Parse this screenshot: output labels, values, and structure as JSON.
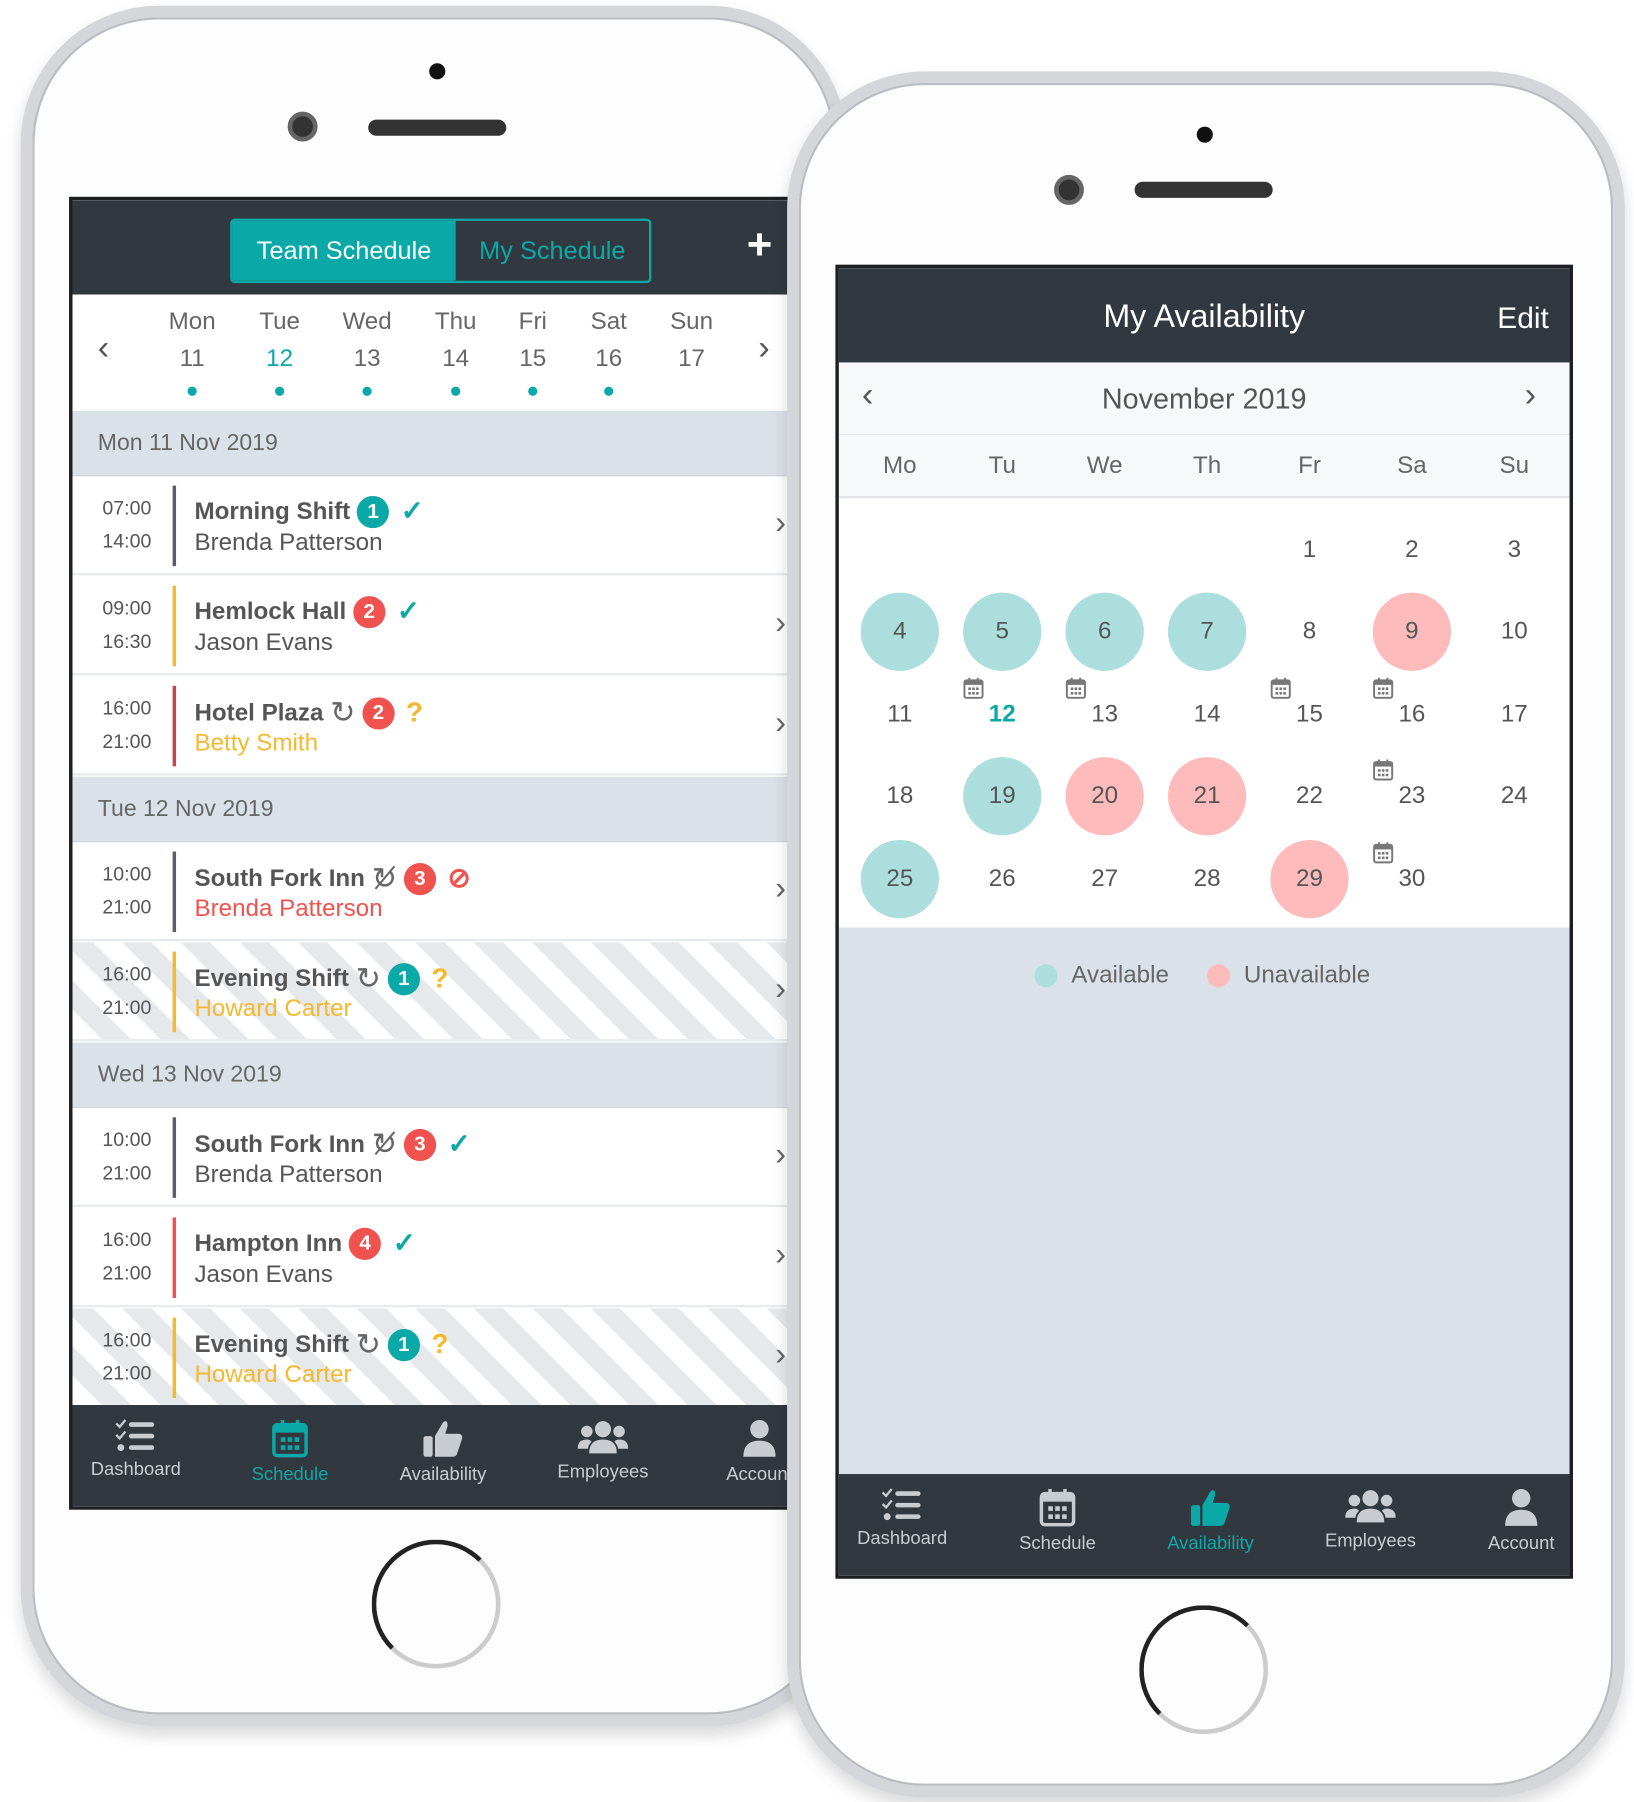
{
  "team_schedule": {
    "tabs": [
      {
        "label": "Team Schedule",
        "active": true
      },
      {
        "label": "My Schedule",
        "active": false
      }
    ],
    "add_icon": "plus-icon",
    "week": [
      {
        "day": "Mon",
        "date": "11",
        "has_shifts": true
      },
      {
        "day": "Tue",
        "date": "12",
        "has_shifts": true,
        "today": true
      },
      {
        "day": "Wed",
        "date": "13",
        "has_shifts": true
      },
      {
        "day": "Thu",
        "date": "14",
        "has_shifts": true
      },
      {
        "day": "Fri",
        "date": "15",
        "has_shifts": true
      },
      {
        "day": "Sat",
        "date": "16",
        "has_shifts": true
      },
      {
        "day": "Sun",
        "date": "17",
        "has_shifts": false
      }
    ],
    "groups": [
      {
        "date": "Mon 11 Nov 2019",
        "shifts": [
          {
            "start": "07:00",
            "end": "14:00",
            "title": "Morning Shift",
            "repeat": "",
            "badge": "1",
            "badge_color": "#0aa8a7",
            "status": "confirmed",
            "employee": "Brenda Patterson",
            "employee_color": "#555555",
            "bar_color": "#5a5f66",
            "striped": false
          },
          {
            "start": "09:00",
            "end": "16:30",
            "title": "Hemlock Hall",
            "repeat": "",
            "badge": "2",
            "badge_color": "#f0534f",
            "status": "confirmed",
            "employee": "Jason Evans",
            "employee_color": "#555555",
            "bar_color": "#f5b82e",
            "striped": false
          },
          {
            "start": "16:00",
            "end": "21:00",
            "title": "Hotel Plaza",
            "repeat": "repeat",
            "badge": "2",
            "badge_color": "#f0534f",
            "status": "pending",
            "employee": "Betty Smith",
            "employee_color": "#f5b82e",
            "bar_color": "#c0474a",
            "striped": false
          }
        ]
      },
      {
        "date": "Tue 12 Nov 2019",
        "shifts": [
          {
            "start": "10:00",
            "end": "21:00",
            "title": "South Fork Inn",
            "repeat": "repeat-off",
            "badge": "3",
            "badge_color": "#f0534f",
            "status": "declined",
            "employee": "Brenda Patterson",
            "employee_color": "#f0534f",
            "bar_color": "#5a5f66",
            "striped": false
          },
          {
            "start": "16:00",
            "end": "21:00",
            "title": "Evening Shift",
            "repeat": "repeat",
            "badge": "1",
            "badge_color": "#0aa8a7",
            "status": "pending",
            "employee": "Howard Carter",
            "employee_color": "#f5b82e",
            "bar_color": "#f5b82e",
            "striped": true
          }
        ]
      },
      {
        "date": "Wed 13 Nov 2019",
        "shifts": [
          {
            "start": "10:00",
            "end": "21:00",
            "title": "South Fork Inn",
            "repeat": "repeat-off",
            "badge": "3",
            "badge_color": "#f0534f",
            "status": "confirmed",
            "employee": "Brenda Patterson",
            "employee_color": "#555555",
            "bar_color": "#5a5f66",
            "striped": false
          },
          {
            "start": "16:00",
            "end": "21:00",
            "title": "Hampton Inn",
            "repeat": "",
            "badge": "4",
            "badge_color": "#f0534f",
            "status": "confirmed",
            "employee": "Jason Evans",
            "employee_color": "#555555",
            "bar_color": "#f0534f",
            "striped": false
          },
          {
            "start": "16:00",
            "end": "21:00",
            "title": "Evening Shift",
            "repeat": "repeat",
            "badge": "1",
            "badge_color": "#0aa8a7",
            "status": "pending",
            "employee": "Howard Carter",
            "employee_color": "#f5b82e",
            "bar_color": "#f5b82e",
            "striped": true
          }
        ]
      }
    ],
    "nav": [
      {
        "label": "Dashboard",
        "icon": "checklist-icon"
      },
      {
        "label": "Schedule",
        "icon": "calendar-icon",
        "active": true
      },
      {
        "label": "Availability",
        "icon": "thumbs-up-icon"
      },
      {
        "label": "Employees",
        "icon": "users-icon"
      },
      {
        "label": "Account",
        "icon": "user-icon"
      }
    ]
  },
  "availability": {
    "title": "My Availability",
    "edit_label": "Edit",
    "month": "November 2019",
    "weekdays": [
      "Mo",
      "Tu",
      "We",
      "Th",
      "Fr",
      "Sa",
      "Su"
    ],
    "days_in_month": 30,
    "first_weekday_index": 4,
    "today": 12,
    "available": [
      4,
      5,
      6,
      7,
      19,
      25
    ],
    "unavailable": [
      9,
      20,
      21,
      29
    ],
    "scheduled": [
      12,
      13,
      15,
      16,
      23,
      30
    ],
    "legend": [
      {
        "label": "Available",
        "color": "#abdedd"
      },
      {
        "label": "Unavailable",
        "color": "#fdbcbb"
      }
    ],
    "nav": [
      {
        "label": "Dashboard",
        "icon": "checklist-icon"
      },
      {
        "label": "Schedule",
        "icon": "calendar-icon"
      },
      {
        "label": "Availability",
        "icon": "thumbs-up-icon",
        "active": true
      },
      {
        "label": "Employees",
        "icon": "users-icon"
      },
      {
        "label": "Account",
        "icon": "user-icon"
      }
    ]
  },
  "colors": {
    "accent": "#0aa8a7",
    "header": "#323840",
    "danger": "#f0534f",
    "warning": "#f5b82e"
  }
}
